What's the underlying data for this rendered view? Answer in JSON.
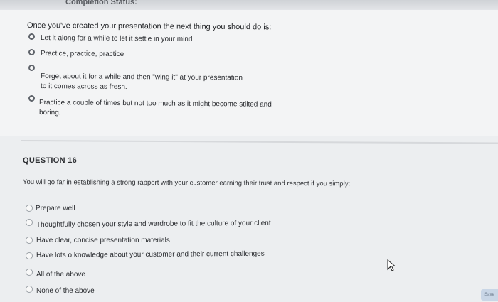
{
  "header": {
    "status_label": "Completion Status:"
  },
  "q15": {
    "question": "Once you've created your presentation the next thing you should do is:",
    "options": [
      "Let it along for a while to let it settle in your mind",
      "Practice, practice, practice",
      "Forget about it for a while and then \"wing it\" at your presentation",
      "to it comes across as fresh.",
      "Practice a couple of times but not too much as it might become stilted and",
      "boring."
    ]
  },
  "q16": {
    "title": "QUESTION 16",
    "prompt": "You will go far in establishing a strong rapport with your customer earning their trust and respect if you simply:",
    "options": [
      "Prepare well",
      "Thoughtfully chosen your style and wardrobe to fit the culture of your client",
      "Have clear, concise presentation materials",
      "Have lots o knowledge about your customer and their current challenges",
      "All of the above",
      "None of the above"
    ]
  },
  "footer": {
    "save_label": "Save"
  }
}
